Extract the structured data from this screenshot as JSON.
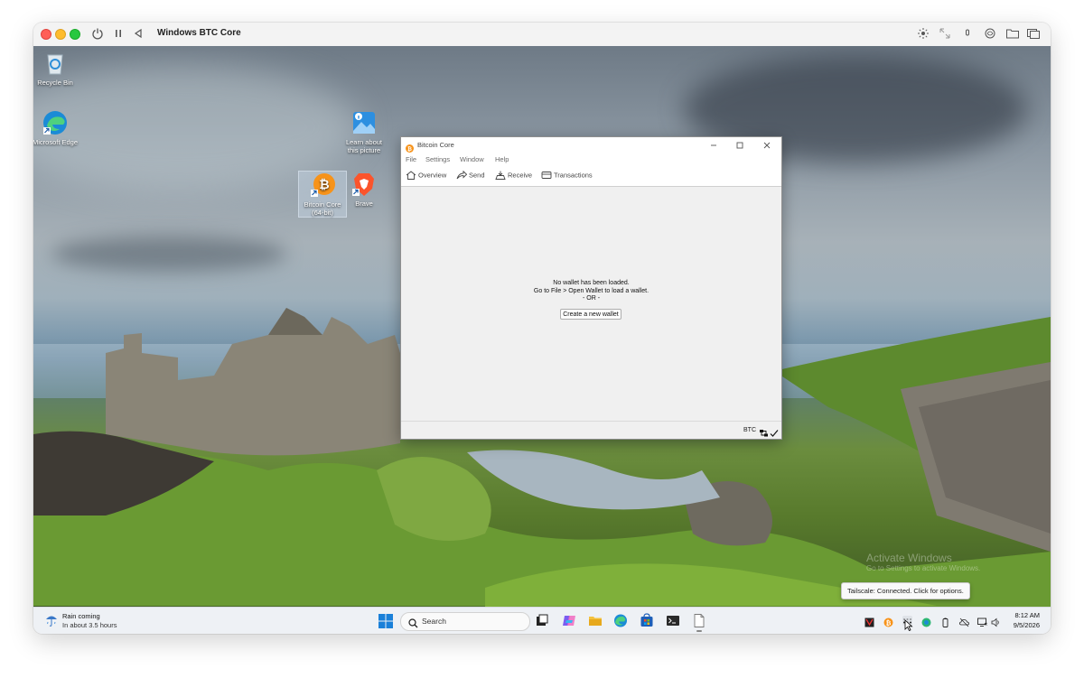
{
  "vm": {
    "title": "Windows BTC Core",
    "left_icons": [
      "power-icon",
      "pause-icon",
      "back-icon"
    ],
    "right_icons": [
      "brightness-icon",
      "resize-icon",
      "microphone-icon",
      "network-icon",
      "folder-icon",
      "display-icon"
    ]
  },
  "desktop": {
    "icons": [
      {
        "label": "Recycle Bin",
        "icon": "recycle-bin-icon"
      },
      {
        "label": "Microsoft Edge",
        "icon": "edge-icon"
      },
      {
        "label": "Learn about this picture",
        "icon": "learn-picture-icon"
      },
      {
        "label": "Bitcoin Core (64-bit)",
        "icon": "bitcoin-core-icon"
      },
      {
        "label": "Brave",
        "icon": "brave-icon"
      }
    ],
    "watermark": {
      "line1": "Activate Windows",
      "line2": "Go to Settings to activate Windows."
    }
  },
  "bitcoin_core": {
    "title": "Bitcoin Core",
    "menu": [
      "File",
      "Settings",
      "Window",
      "Help"
    ],
    "toolbar": [
      {
        "label": "Overview",
        "icon": "home-icon"
      },
      {
        "label": "Send",
        "icon": "send-icon"
      },
      {
        "label": "Receive",
        "icon": "receive-icon"
      },
      {
        "label": "Transactions",
        "icon": "transactions-icon"
      }
    ],
    "message": {
      "line1": "No wallet has been loaded.",
      "line2": "Go to File > Open Wallet to load a wallet.",
      "line3": "- OR -"
    },
    "create_wallet_label": "Create a new wallet",
    "status": {
      "unit": "BTC"
    }
  },
  "tooltip": "Tailscale: Connected. Click for options.",
  "taskbar": {
    "weather": {
      "line1": "Rain coming",
      "line2": "In about 3.5 hours"
    },
    "search_placeholder": "Search",
    "apps": [
      "task-view-icon",
      "copilot-icon",
      "file-explorer-icon",
      "edge-icon",
      "store-icon",
      "terminal-icon",
      "notepad-icon"
    ],
    "tray_icons": [
      "tray-app-icon",
      "bitcoin-tray-icon",
      "tailscale-icon",
      "shield-icon",
      "battery-icon",
      "cloud-off-icon",
      "network-icon",
      "volume-icon"
    ],
    "time": "8:12 AM",
    "date": "9/5/2026"
  }
}
